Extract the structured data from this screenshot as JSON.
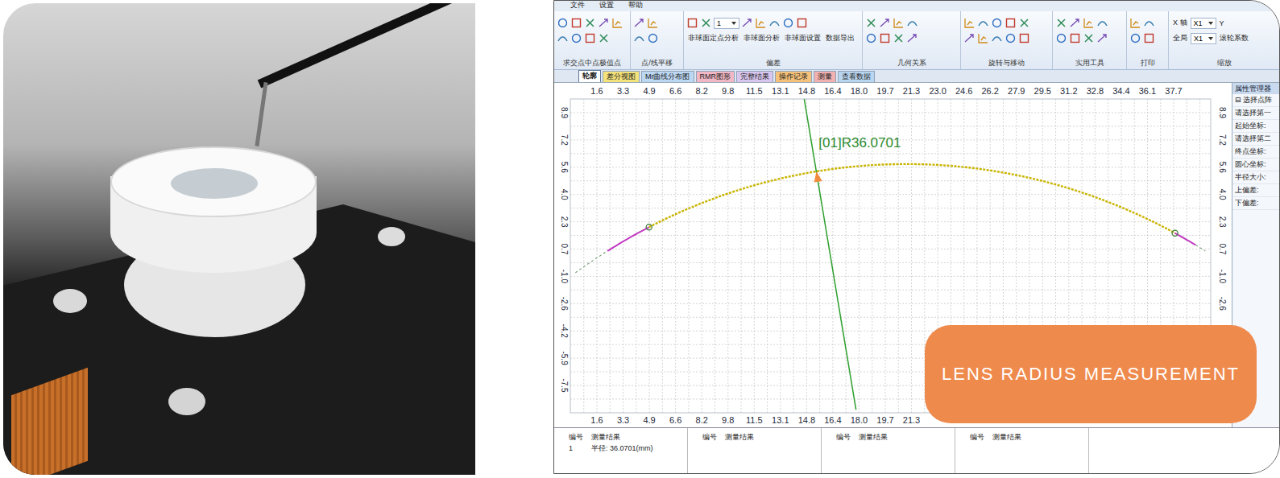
{
  "menu": [
    "文件",
    "设置",
    "帮助"
  ],
  "ribbon": {
    "groups": [
      {
        "label": "求交点中点极值点",
        "texts": []
      },
      {
        "label": "点/线平移",
        "texts": []
      },
      {
        "label": "偏差",
        "texts": [
          "1",
          "非球面定点分析",
          "非球面分析",
          "非球面设置",
          "数据导出"
        ]
      },
      {
        "label": "几何关系",
        "texts": []
      },
      {
        "label": "旋转与移动",
        "texts": []
      },
      {
        "label": "实用工具",
        "texts": []
      },
      {
        "label": "打印",
        "texts": []
      },
      {
        "label": "缩放",
        "texts": [
          "X 轴",
          "X1",
          "Y",
          "全局",
          "X1",
          "滚轮系数"
        ]
      }
    ]
  },
  "tabs": [
    {
      "label": "轮廓",
      "selected": true,
      "color": "#ffffff"
    },
    {
      "label": "差分视图",
      "selected": false,
      "color": "#f4e27a"
    },
    {
      "label": "Mr曲线分布图",
      "selected": false,
      "color": "#bcd7f2"
    },
    {
      "label": "RMR图形",
      "selected": false,
      "color": "#f2b7c4"
    },
    {
      "label": "完整结果",
      "selected": false,
      "color": "#d9c6ee"
    },
    {
      "label": "操作记录",
      "selected": false,
      "color": "#f6c27a"
    },
    {
      "label": "测量",
      "selected": false,
      "color": "#f2b0b0"
    },
    {
      "label": "查看数据",
      "selected": false,
      "color": "#b9d6f0"
    }
  ],
  "chart": {
    "x_ticks_top": [
      {
        "label": "1.6",
        "value": 1.64
      },
      {
        "label": "3.3",
        "value": 3.28
      },
      {
        "label": "4.9",
        "value": 4.92
      },
      {
        "label": "6.6",
        "value": 6.56
      },
      {
        "label": "8.2",
        "value": 8.2
      },
      {
        "label": "9.8",
        "value": 9.84
      },
      {
        "label": "11.5",
        "value": 11.48
      },
      {
        "label": "13.1",
        "value": 13.12
      },
      {
        "label": "14.8",
        "value": 14.76
      },
      {
        "label": "16.4",
        "value": 16.4
      },
      {
        "label": "18.0",
        "value": 18.04
      },
      {
        "label": "19.7",
        "value": 19.68
      },
      {
        "label": "21.3",
        "value": 21.32
      },
      {
        "label": "23.0",
        "value": 22.96
      },
      {
        "label": "24.6",
        "value": 24.6
      },
      {
        "label": "26.2",
        "value": 26.24
      },
      {
        "label": "27.9",
        "value": 27.88
      },
      {
        "label": "29.5",
        "value": 29.52
      },
      {
        "label": "31.2",
        "value": 31.16
      },
      {
        "label": "32.8",
        "value": 32.8
      },
      {
        "label": "34.4",
        "value": 34.44
      },
      {
        "label": "36.1",
        "value": 36.08
      },
      {
        "label": "37.7",
        "value": 37.72
      }
    ],
    "x_ticks_bottom": [
      {
        "label": "1.6",
        "value": 1.64
      },
      {
        "label": "3.3",
        "value": 3.28
      },
      {
        "label": "4.9",
        "value": 4.92
      },
      {
        "label": "6.6",
        "value": 6.56
      },
      {
        "label": "8.2",
        "value": 8.2
      },
      {
        "label": "9.8",
        "value": 9.84
      },
      {
        "label": "11.5",
        "value": 11.48
      },
      {
        "label": "13.1",
        "value": 13.12
      },
      {
        "label": "14.8",
        "value": 14.76
      },
      {
        "label": "16.4",
        "value": 16.4
      },
      {
        "label": "18.0",
        "value": 18.04
      },
      {
        "label": "19.7",
        "value": 19.68
      },
      {
        "label": "21.3",
        "value": 21.32
      }
    ],
    "y_ticks_left": [
      {
        "label": "8.9",
        "value": 8.86
      },
      {
        "label": "7.2",
        "value": 7.22
      },
      {
        "label": "5.6",
        "value": 5.58
      },
      {
        "label": "4.0",
        "value": 3.94
      },
      {
        "label": "2.3",
        "value": 2.3
      },
      {
        "label": "0.7",
        "value": 0.66
      },
      {
        "label": "-1.0",
        "value": -0.98
      },
      {
        "label": "-2.6",
        "value": -2.62
      },
      {
        "label": "-4.2",
        "value": -4.26
      },
      {
        "label": "-5.9",
        "value": -5.9
      },
      {
        "label": "-7.5",
        "value": -7.54
      }
    ],
    "y_ticks_right": [
      {
        "label": "8.9",
        "value": 8.86
      },
      {
        "label": "7.2",
        "value": 7.22
      },
      {
        "label": "5.6",
        "value": 5.58
      },
      {
        "label": "4.0",
        "value": 3.94
      },
      {
        "label": "2.3",
        "value": 2.3
      },
      {
        "label": "0.7",
        "value": 0.66
      },
      {
        "label": "-1.0",
        "value": -0.98
      },
      {
        "label": "-2.6",
        "value": -2.62
      }
    ],
    "circle": {
      "center_x": 21.0,
      "center_y": -30.3,
      "radius": 36.07
    },
    "segments": [
      {
        "kind": "extension",
        "from": 0.3,
        "to": 2.3,
        "color": "#7fa07f"
      },
      {
        "kind": "residual",
        "from": 2.3,
        "to": 4.9,
        "color": "#c23bc2"
      },
      {
        "kind": "fit",
        "from": 4.9,
        "to": 37.8,
        "color": "#c9b400"
      },
      {
        "kind": "residual",
        "from": 37.8,
        "to": 39.1,
        "color": "#c23bc2"
      },
      {
        "kind": "extension",
        "from": 39.1,
        "to": 39.7,
        "color": "#7fa07f"
      }
    ],
    "markers": [
      {
        "x": 4.9
      },
      {
        "x": 37.8
      }
    ],
    "radius_line": {
      "x1": 14.61,
      "y1": 9.68,
      "x2": 17.85,
      "y2": -9.0
    },
    "arrow": {
      "x": 15.37,
      "y": 5.33
    },
    "annotation": "[01]R36.0701"
  },
  "properties": {
    "title": "属性管理器",
    "section_icon": "⊟",
    "section": "选择点阵",
    "rows": [
      "请选择第一",
      "起始坐标:",
      "请选择第二",
      "终点坐标:",
      "圆心坐标:",
      "半径大小:",
      "上偏差:",
      "下偏差:"
    ]
  },
  "results": {
    "groups": [
      {
        "columns": [
          "编号",
          "测量结果"
        ],
        "rows": [
          [
            "1",
            "半径: 36.0701(mm)"
          ]
        ]
      },
      {
        "columns": [
          "编号",
          "测量结果"
        ],
        "rows": []
      },
      {
        "columns": [
          "编号",
          "测量结果"
        ],
        "rows": []
      },
      {
        "columns": [
          "编号",
          "测量结果"
        ],
        "rows": []
      }
    ]
  },
  "badge": "LENS RADIUS MEASUREMENT"
}
